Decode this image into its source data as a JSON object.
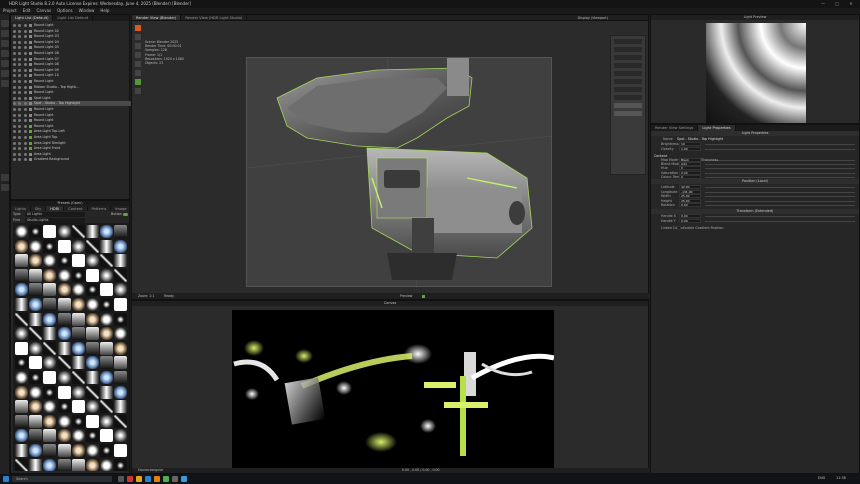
{
  "window": {
    "title": "HDR Light Studio 8.2.0  Auto License Expires: Wednesday, June 4, 2025  (Blender)  [Blender]",
    "controls": [
      "—",
      "□",
      "✕"
    ]
  },
  "menu": [
    "Project",
    "Edit",
    "Canvas",
    "Options",
    "Window",
    "Help"
  ],
  "layers_panel": {
    "tabs": [
      "Light List (Default)",
      "Light List Default"
    ],
    "items": [
      {
        "label": "Round Light",
        "green": false
      },
      {
        "label": "Round Light 02",
        "green": false
      },
      {
        "label": "Round Light 03",
        "green": false
      },
      {
        "label": "Round Light 04",
        "green": false
      },
      {
        "label": "Round Light 05",
        "green": false
      },
      {
        "label": "Round Light 06",
        "green": false
      },
      {
        "label": "Round Light 07",
        "green": false
      },
      {
        "label": "Round Light 08",
        "green": false
      },
      {
        "label": "Round Light 09",
        "green": false
      },
      {
        "label": "Round Light 10",
        "green": false
      },
      {
        "label": "Round Light",
        "green": false
      },
      {
        "label": "Ribbon Studio - Top Highli...",
        "green": false
      },
      {
        "label": "Round Light",
        "green": false
      },
      {
        "label": "Spot Light",
        "green": false
      },
      {
        "label": "Spot - Studio - Top Highlight",
        "green": false,
        "selected": true
      },
      {
        "label": "Round Light",
        "green": false
      },
      {
        "label": "Round Light",
        "green": false
      },
      {
        "label": "Round Light",
        "green": false
      },
      {
        "label": "Round Light",
        "green": true
      },
      {
        "label": "Area Light Top-Left",
        "green": true
      },
      {
        "label": "Area Light Top",
        "green": true
      },
      {
        "label": "Area Light Rimlight",
        "green": true
      },
      {
        "label": "Area Light Front",
        "green": true
      },
      {
        "label": "Area Light",
        "green": false
      },
      {
        "label": "Gradient Background",
        "green": false
      }
    ]
  },
  "preset_panel": {
    "title": "Presets (Open)",
    "tabs": [
      "Lights",
      "Sky",
      "HDRI",
      "Content",
      "Patterns",
      "Image"
    ],
    "type_label": "Type",
    "type_value": "All Lights",
    "find_label": "Find",
    "find_value": "Studio Lights",
    "button_label": "Button"
  },
  "viewport": {
    "tabs": [
      "Render View (Blender)",
      "Render View (HDR Light Studio)"
    ],
    "toolbar_right": "Display (Viewport)",
    "overlay_lines": [
      "Scene:  Blender 2025",
      "Render Time: 00:00:01",
      "Samples: 128",
      "Frame: 1/1",
      "Resolution: 1920 x 1080",
      "Objects: 23"
    ],
    "footer_left": "Zoom: 1:1",
    "footer_mid": "Preview",
    "footer_status": "Ready"
  },
  "canvas": {
    "title": "Canvas",
    "footer_left": "Equirectangular",
    "footer_right": "0.00 , 0.00 / 0.00 , 0.00"
  },
  "light_preview": {
    "title": "Light Preview"
  },
  "properties": {
    "tabs": [
      "Render View Settings",
      "Light Properties"
    ],
    "title": "Light Properties",
    "name_label": "Name",
    "name_value": "Spot - Studio - Top Highlight",
    "rows": [
      {
        "label": "Brightness",
        "value": "10"
      },
      {
        "label": "Opacity",
        "value": "1.00"
      }
    ],
    "group_label": "Content",
    "content_rows": [
      {
        "label": "Map Mode",
        "value": "Black"
      },
      {
        "label": "Blend Mode",
        "value": "Add"
      },
      {
        "label": "Hue",
        "value": "0"
      },
      {
        "label": "Saturation",
        "value": "0.00"
      },
      {
        "label": "Colour Temp",
        "value": "0"
      }
    ],
    "position_header": "Position (Local)",
    "position_rows": [
      {
        "label": "Latitude",
        "value": "42.90"
      },
      {
        "label": "Longitude",
        "value": "-131.00"
      },
      {
        "label": "Width",
        "value": "25.00"
      },
      {
        "label": "Height",
        "value": "25.00"
      },
      {
        "label": "Rotation",
        "value": "0.00"
      }
    ],
    "transform_header": "Transform (Extended)",
    "transform_rows": [
      {
        "label": "Handle X",
        "value": "0.00"
      },
      {
        "label": "Handle Y",
        "value": "0.00"
      }
    ],
    "checkbox_label": "Enable Gradient Position",
    "checkbox2_label": "Sharpness",
    "swatch_label": "Linked Colour"
  },
  "taskbar": {
    "search_placeholder": "Search",
    "right_text": "ENG",
    "time": "11:38"
  },
  "colors": {
    "accent": "#5fa63a",
    "viewport_bg": "#2b2b2b",
    "canvas_bg": "#000000"
  }
}
